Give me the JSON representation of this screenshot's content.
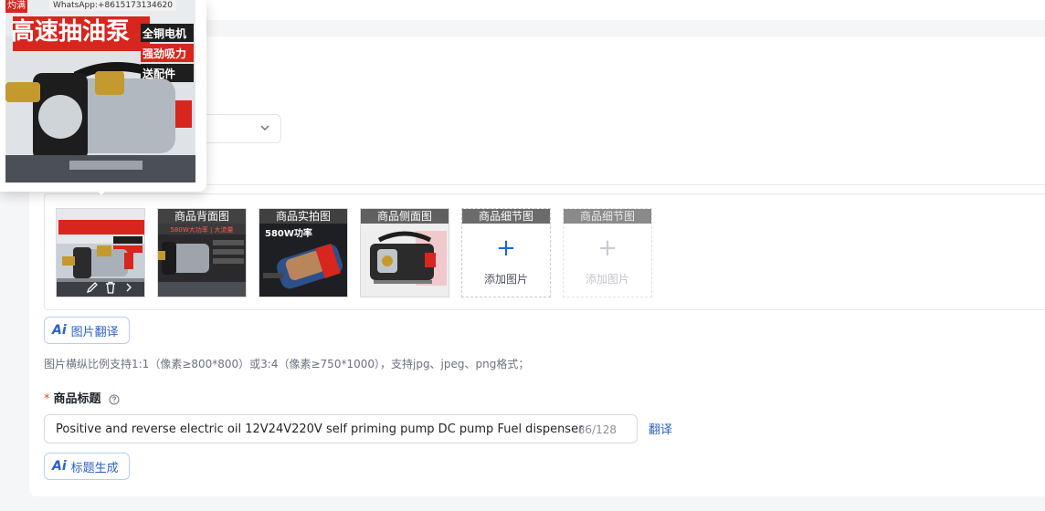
{
  "popup": {
    "watermark": "WhatsApp:+8615173134620",
    "corner_tag": "灼满",
    "headline": "高速抽油泵",
    "badges": [
      "全铜电机",
      "强劲吸力",
      "送配件"
    ]
  },
  "images": {
    "slots": [
      {
        "label": "",
        "filled": true
      },
      {
        "label": "商品背面图",
        "filled": true,
        "caption": "580W大功率 | 大流量"
      },
      {
        "label": "商品实拍图",
        "filled": true,
        "caption": "580W功率"
      },
      {
        "label": "商品侧面图",
        "filled": true
      },
      {
        "label": "商品细节图",
        "filled": false,
        "add_text": "添加图片"
      },
      {
        "label": "商品细节图",
        "filled": false,
        "disabled": true,
        "add_text": "添加图片"
      }
    ],
    "translate_button": "图片翻译",
    "hint": "图片横纵比例支持1:1（像素≥800*800）或3:4（像素≥750*1000），支持jpg、jpeg、png格式；"
  },
  "title_field": {
    "required_mark": "*",
    "label": "商品标题",
    "value": "Positive and reverse electric oil  12V24V220V self priming pump DC pump Fuel dispenser",
    "counter": "86/128",
    "translate_link": "翻译",
    "generate_button": "标题生成"
  },
  "ai_mark": "Ai",
  "colors": {
    "accent": "#2b5fc9",
    "required": "#e5483a",
    "badge_red": "#d7261e"
  }
}
